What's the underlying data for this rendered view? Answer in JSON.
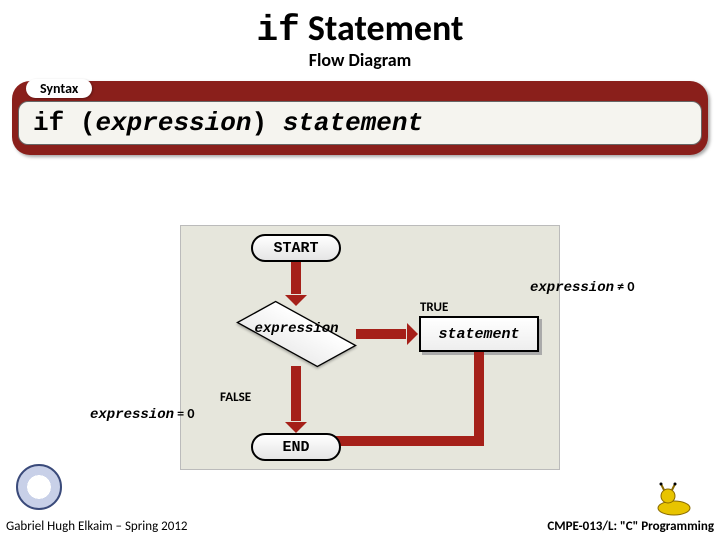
{
  "title": {
    "keyword": "if",
    "rest": "Statement"
  },
  "subtitle": "Flow Diagram",
  "syntax": {
    "tab": "Syntax",
    "keyword": "if",
    "lparen": "(",
    "expression": "expression",
    "rparen": ")",
    "statement": "statement"
  },
  "flow": {
    "start": "START",
    "end": "END",
    "decision": "expression",
    "action": "statement"
  },
  "annotations": {
    "true_label": "TRUE",
    "true_condition_var": "expression",
    "true_condition_rest": " ≠ 0",
    "false_label": "FALSE",
    "false_condition_var": "expression",
    "false_condition_rest": " = 0"
  },
  "footer": {
    "left": "Gabriel Hugh Elkaim – Spring 2012",
    "right": "CMPE-013/L: \"C\" Programming"
  }
}
